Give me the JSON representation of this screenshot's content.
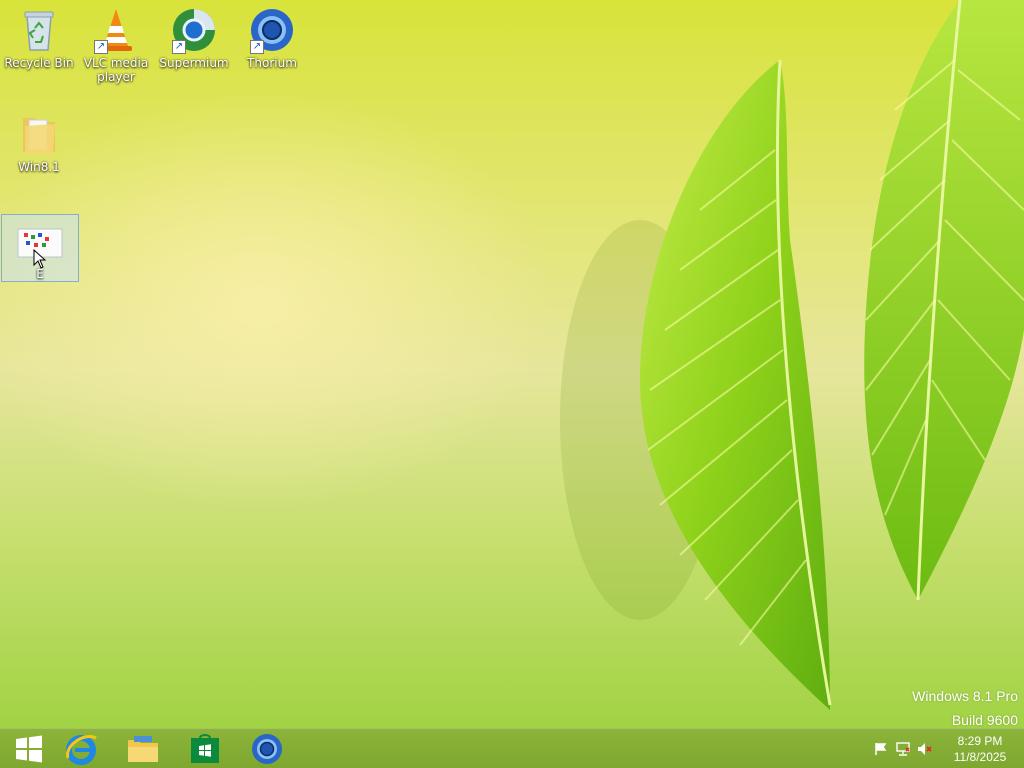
{
  "desktop": {
    "icons": [
      {
        "label": "Recycle Bin",
        "icon": "recycle-bin-icon"
      },
      {
        "label": "VLC media player",
        "icon": "vlc-icon",
        "shortcut": true
      },
      {
        "label": "Supermium",
        "icon": "supermium-icon",
        "shortcut": true
      },
      {
        "label": "Thorium",
        "icon": "thorium-icon",
        "shortcut": true
      },
      {
        "label": "Win8.1",
        "icon": "folder-icon"
      },
      {
        "label": "E",
        "icon": "image-file-icon",
        "selected": true
      }
    ]
  },
  "watermark": {
    "line1": "Windows 8.1 Pro",
    "line2": "Build 9600"
  },
  "taskbar": {
    "pinned": [
      {
        "name": "Start",
        "icon": "windows-logo-icon"
      },
      {
        "name": "Internet Explorer",
        "icon": "internet-explorer-icon"
      },
      {
        "name": "File Explorer",
        "icon": "file-explorer-icon"
      },
      {
        "name": "Store",
        "icon": "store-icon"
      },
      {
        "name": "Thorium",
        "icon": "thorium-icon"
      }
    ],
    "tray": {
      "icons": [
        "action-center-flag-icon",
        "network-icon",
        "volume-muted-icon"
      ],
      "time": "8:29 PM",
      "date": "11/8/2025"
    }
  },
  "colors": {
    "taskbar": "#84ad35",
    "leaf": "#8ed21c"
  }
}
